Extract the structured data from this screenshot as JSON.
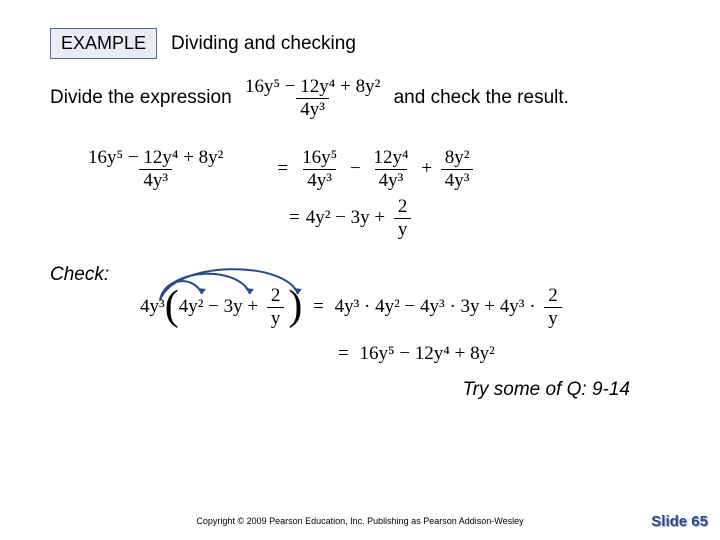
{
  "header": {
    "badge": "EXAMPLE",
    "title": "Dividing and checking"
  },
  "problem": {
    "pre": "Divide the expression",
    "post": "and check the result.",
    "frac_num": "16y⁵ − 12y⁴ + 8y²",
    "frac_den": "4y³"
  },
  "work": {
    "lhs_num": "16y⁵ − 12y⁴ + 8y²",
    "lhs_den": "4y³",
    "r1a_num": "16y⁵",
    "r1a_den": "4y³",
    "r1b_num": "12y⁴",
    "r1b_den": "4y³",
    "r1c_num": "8y²",
    "r1c_den": "4y³",
    "r2a": "4y²",
    "r2b": "3y",
    "r2c_num": "2",
    "r2c_den": "y"
  },
  "check": {
    "label": "Check:",
    "factor": "4y³",
    "t1": "4y²",
    "t2": "3y",
    "t3_num": "2",
    "t3_den": "y",
    "rhs1a": "4y³",
    "rhs1b": "4y²",
    "rhs1c": "3y",
    "rhs1d_num": "2",
    "rhs1d_den": "y",
    "rhs2": "16y⁵ − 12y⁴ + 8y²"
  },
  "try": "Try some of Q: 9-14",
  "copyright": "Copyright © 2009 Pearson Education, Inc.  Publishing as Pearson Addison-Wesley",
  "slide": "Slide 65"
}
